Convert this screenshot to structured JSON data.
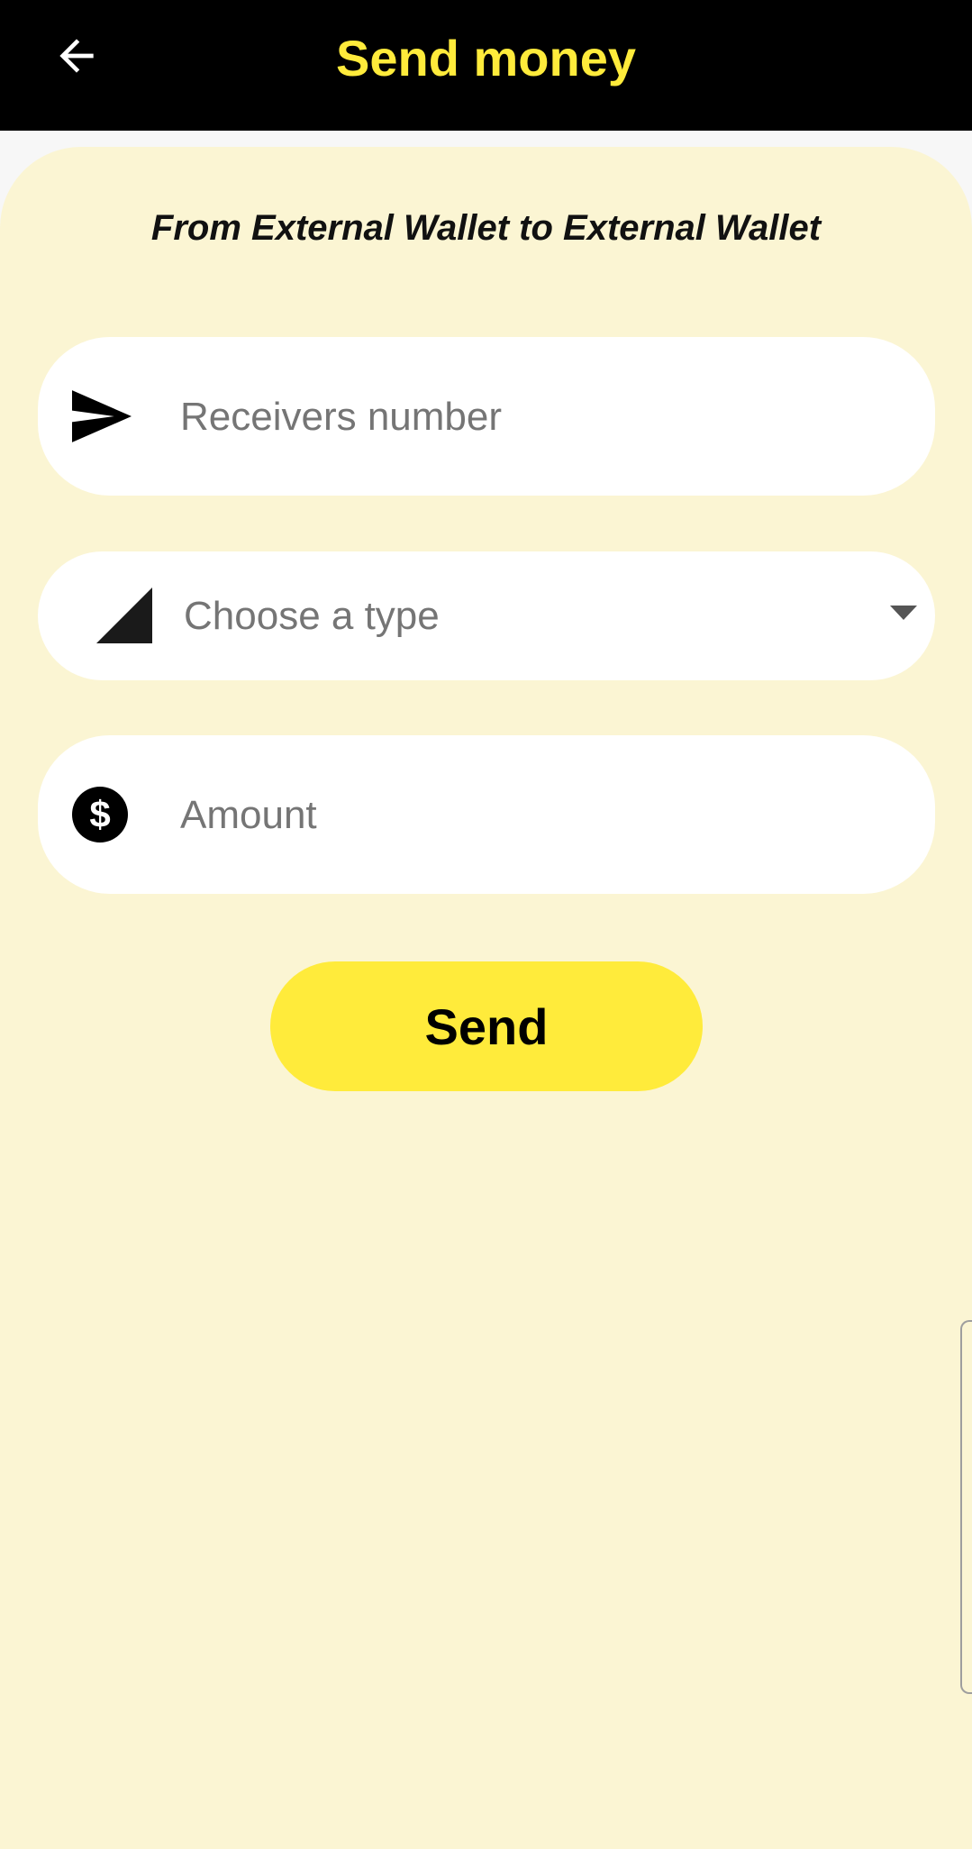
{
  "header": {
    "title": "Send money",
    "back_icon": "arrow-left-icon",
    "background_color": "#000000",
    "title_color": "#ffeb3b"
  },
  "form": {
    "subtitle": "From External Wallet to External Wallet",
    "receiver": {
      "icon": "send-icon",
      "placeholder": "Receivers number",
      "value": ""
    },
    "type_select": {
      "icon": "signal-icon",
      "selected_label": "Choose a type",
      "dropdown_icon": "caret-down-icon"
    },
    "amount": {
      "icon": "dollar-circle-icon",
      "placeholder": "Amount",
      "value": ""
    },
    "send_label": "Send"
  },
  "colors": {
    "accent": "#ffeb3b",
    "sheet_background": "#fbf5d3",
    "field_background": "#ffffff",
    "placeholder_text": "#757575"
  }
}
